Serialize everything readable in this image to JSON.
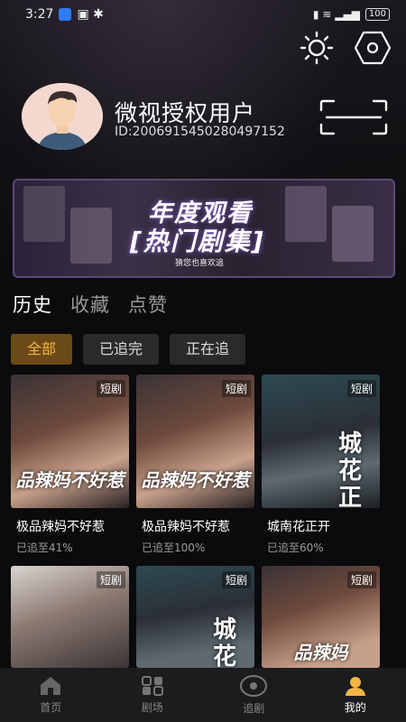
{
  "status_bar": {
    "time": "3:27",
    "battery": "100"
  },
  "profile": {
    "name": "微视授权用户",
    "id": "ID:2006915450280497152"
  },
  "banner": {
    "title_line1": "年度观看",
    "title_line2": "[热门剧集]",
    "subtitle": "猜您也喜欢追"
  },
  "tabs": [
    "历史",
    "收藏",
    "点赞"
  ],
  "filters": [
    "全部",
    "已追完",
    "正在追"
  ],
  "cards": [
    {
      "tag": "短剧",
      "title": "极品辣妈不好惹",
      "progress": "已追至41%",
      "poster_text": "品辣妈不好惹"
    },
    {
      "tag": "短剧",
      "title": "极品辣妈不好惹",
      "progress": "已追至100%",
      "poster_text": "品辣妈不好惹"
    },
    {
      "tag": "短剧",
      "title": "城南花正开",
      "progress": "已追至60%",
      "poster_text": "城花正开"
    },
    {
      "tag": "短剧",
      "title": "",
      "progress": "",
      "poster_text": ""
    },
    {
      "tag": "短剧",
      "title": "",
      "progress": "",
      "poster_text": "城花"
    },
    {
      "tag": "短剧",
      "title": "",
      "progress": "",
      "poster_text": "品辣妈"
    }
  ],
  "nav": [
    {
      "label": "首页",
      "icon": "home-icon"
    },
    {
      "label": "剧场",
      "icon": "theater-icon"
    },
    {
      "label": "追剧",
      "icon": "follow-icon"
    },
    {
      "label": "我的",
      "icon": "profile-icon"
    }
  ],
  "colors": {
    "accent": "#f4b544",
    "chip_active_bg": "#6b4a17",
    "background": "#0b0b0d"
  }
}
